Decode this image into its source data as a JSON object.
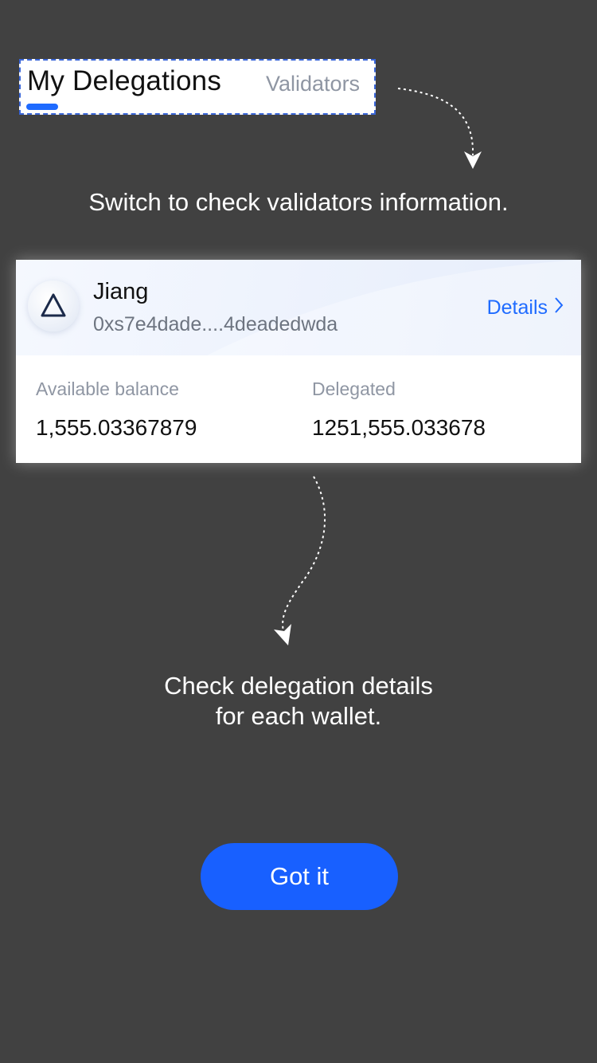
{
  "tabs": {
    "active_label": "My Delegations",
    "inactive_label": "Validators"
  },
  "hints": {
    "top": "Switch to check validators information.",
    "bottom_line1": "Check delegation details",
    "bottom_line2": "for each wallet."
  },
  "wallet": {
    "name": "Jiang",
    "address": "0xs7e4dade....4deadedwda",
    "details_label": "Details",
    "icon": "delta-icon",
    "available_label": "Available balance",
    "available_value": "1,555.03367879",
    "delegated_label": "Delegated",
    "delegated_value": "1251,555.033678"
  },
  "button": {
    "label": "Got it"
  },
  "colors": {
    "overlay": "#414141",
    "accent": "#1f6bff",
    "button": "#1860ff"
  }
}
